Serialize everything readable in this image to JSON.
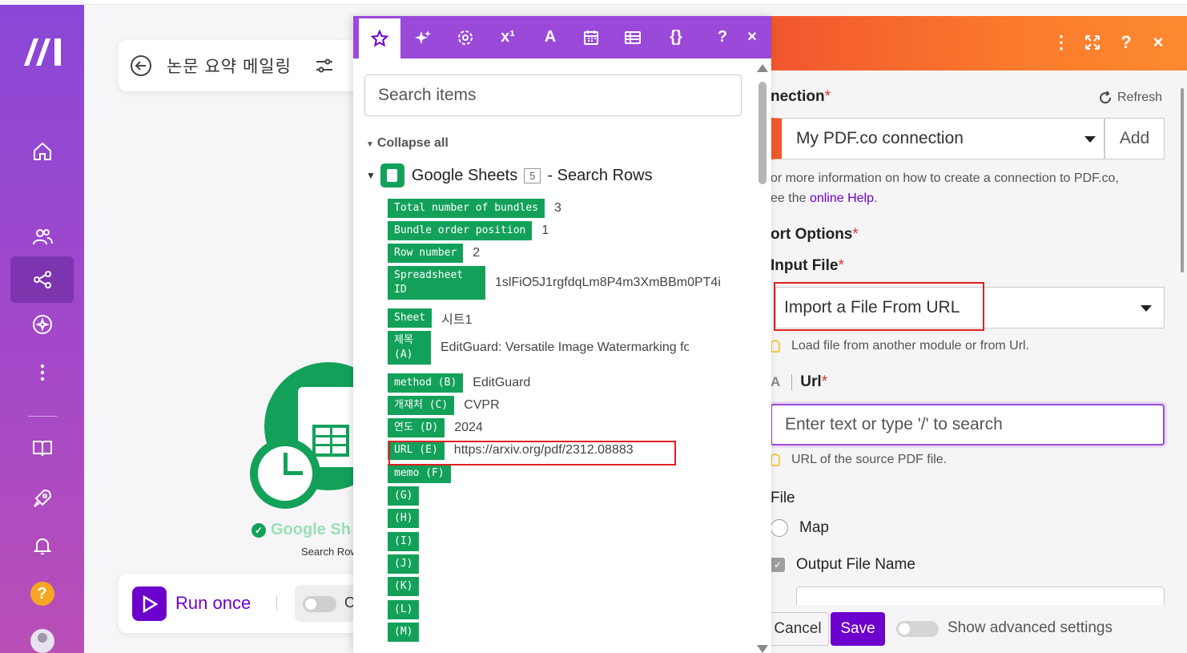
{
  "colors": {
    "brand_purple": "#6d00cc",
    "sidebar_top": "#8a47d6",
    "mapper_tabs": "#9a49d8",
    "sheets_green": "#13a15a",
    "pdfco_orange": "#f1542e",
    "highlight_red": "#e02020"
  },
  "scenario": {
    "title": "논문 요약 메일링"
  },
  "module": {
    "name": "Google Sh",
    "subtitle": "Search Row"
  },
  "bottom_bar": {
    "run_label": "Run once",
    "toggle_label": "O"
  },
  "mapper": {
    "tabs": [
      {
        "icon": "star-icon"
      },
      {
        "icon": "sparkle-icon"
      },
      {
        "icon": "gear-icon"
      },
      {
        "icon": "superscript-icon",
        "label": "x¹"
      },
      {
        "icon": "text-icon",
        "label": "A"
      },
      {
        "icon": "calendar-icon"
      },
      {
        "icon": "table-icon"
      },
      {
        "icon": "braces-icon",
        "label": "{}"
      },
      {
        "icon": "help-icon",
        "label": "?"
      },
      {
        "icon": "close-icon",
        "label": "×"
      }
    ],
    "search_placeholder": "Search items",
    "collapse_all": "Collapse all",
    "source": {
      "app": "Google Sheets",
      "count": "5",
      "action": "- Search Rows"
    },
    "items": [
      {
        "key": "Total number of bundles",
        "value": "3"
      },
      {
        "key": "Bundle order position",
        "value": "1"
      },
      {
        "key": "Row number",
        "value": "2"
      },
      {
        "key": "Spreadsheet ID",
        "value": "1slFiO5J1rgfdqLm8P4m3XmBBm0PT4i"
      },
      {
        "key": "Sheet",
        "value": "시트1"
      },
      {
        "key": "제목 (A)",
        "value": "EditGuard: Versatile Image Watermarking for Tam"
      },
      {
        "key": "method (B)",
        "value": "EditGuard"
      },
      {
        "key": "개재처 (C)",
        "value": "CVPR"
      },
      {
        "key": "연도 (D)",
        "value": "2024"
      },
      {
        "key": "URL (E)",
        "value": "https://arxiv.org/pdf/2312.08883"
      },
      {
        "key": "memo (F)",
        "value": ""
      },
      {
        "key": "(G)",
        "value": ""
      },
      {
        "key": "(H)",
        "value": ""
      },
      {
        "key": "(I)",
        "value": ""
      },
      {
        "key": "(J)",
        "value": ""
      },
      {
        "key": "(K)",
        "value": ""
      },
      {
        "key": "(L)",
        "value": ""
      },
      {
        "key": "(M)",
        "value": ""
      }
    ]
  },
  "settings": {
    "header_icons": [
      "more-icon",
      "expand-icon",
      "help-icon",
      "close-icon"
    ],
    "connection_label": "nection",
    "refresh_label": "Refresh",
    "connection_value": "My PDF.co connection",
    "add_label": "Add",
    "help_text_1": "or more information on how to create a connection to PDF.co,",
    "help_text_2": "ee the ",
    "help_link": "online Help",
    "help_text_3": ".",
    "import_options_label": "ort Options",
    "input_file_label": "Input File",
    "input_file_value": "Import a File From URL",
    "input_file_hint": "Load file from another module or from Url.",
    "url_type_icon": "A",
    "url_label": "Url",
    "url_placeholder": "Enter text or type '/' to search",
    "url_hint": "URL of the source PDF file.",
    "file_label": "File",
    "map_label": "Map",
    "output_label": "Output File Name",
    "cancel_label": "Cancel",
    "save_label": "Save",
    "advanced_label": "Show advanced settings"
  }
}
